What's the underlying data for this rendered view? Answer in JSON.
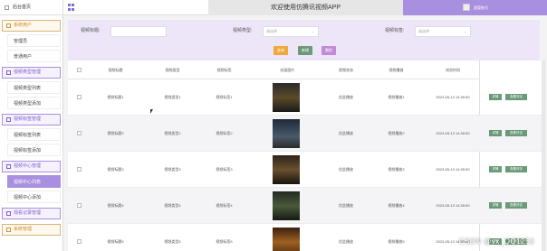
{
  "header": {
    "crumb": "后台首页",
    "title": "欢迎使用仿腾讯视频APP",
    "user": "超管账号"
  },
  "sidebar": {
    "items": [
      {
        "type": "cat",
        "label": "系统用户",
        "style": "orange"
      },
      {
        "type": "item",
        "label": "管理员"
      },
      {
        "type": "item",
        "label": "普通用户"
      },
      {
        "type": "cat",
        "label": "视频类型管理",
        "style": "purple"
      },
      {
        "type": "item",
        "label": "视频类型列表"
      },
      {
        "type": "item",
        "label": "视频类型添加"
      },
      {
        "type": "cat",
        "label": "视频标签管理",
        "style": "purple"
      },
      {
        "type": "item",
        "label": "视频标签列表"
      },
      {
        "type": "item",
        "label": "视频标签添加"
      },
      {
        "type": "cat",
        "label": "视频中心管理",
        "style": "purple"
      },
      {
        "type": "item",
        "label": "视频中心列表",
        "active": true
      },
      {
        "type": "item",
        "label": "视频中心添加"
      },
      {
        "type": "cat",
        "label": "观看记录管理",
        "style": "purple"
      },
      {
        "type": "cat",
        "label": "系统管理",
        "style": "orange"
      }
    ]
  },
  "search": {
    "title_label": "视频标题:",
    "type_label": "视频类型:",
    "type_placeholder": "请选择",
    "tag_label": "视频标签:",
    "tag_placeholder": "请选择",
    "btn_search": "查询",
    "btn_add": "新增",
    "btn_delete": "删除"
  },
  "table": {
    "headers": [
      "视频标题",
      "视频类型",
      "视频标签",
      "封面图片",
      "视频状态",
      "视频播放",
      "浏览时间",
      "操作"
    ],
    "rows": [
      {
        "title": "视频标题1",
        "type": "视频类型1",
        "tag": "视频标签1",
        "status": "优此播放",
        "play": "视频播放1",
        "time": "2023-05-13 14:35:50"
      },
      {
        "title": "视频标题2",
        "type": "视频类型2",
        "tag": "视频标签2",
        "status": "优此播放",
        "play": "视频播放2",
        "time": "2023-05-13 14:35:50"
      },
      {
        "title": "视频标题3",
        "type": "视频类型3",
        "tag": "视频标签3",
        "status": "优此播放",
        "play": "视频播放3",
        "time": "2023-05-13 14:35:50"
      },
      {
        "title": "视频标题4",
        "type": "视频类型4",
        "tag": "视频标签4",
        "status": "优此播放",
        "play": "视频播放4",
        "time": "2023-05-13 14:35:50"
      },
      {
        "title": "视频标题5",
        "type": "视频类型5",
        "tag": "视频标签5",
        "status": "优此播放",
        "play": "视频播放5",
        "time": "2023-05-13 14:35:50"
      }
    ],
    "btn_detail": "详情",
    "btn_review": "查看评论"
  },
  "watermark": "CSDN @vx_QQ1253"
}
